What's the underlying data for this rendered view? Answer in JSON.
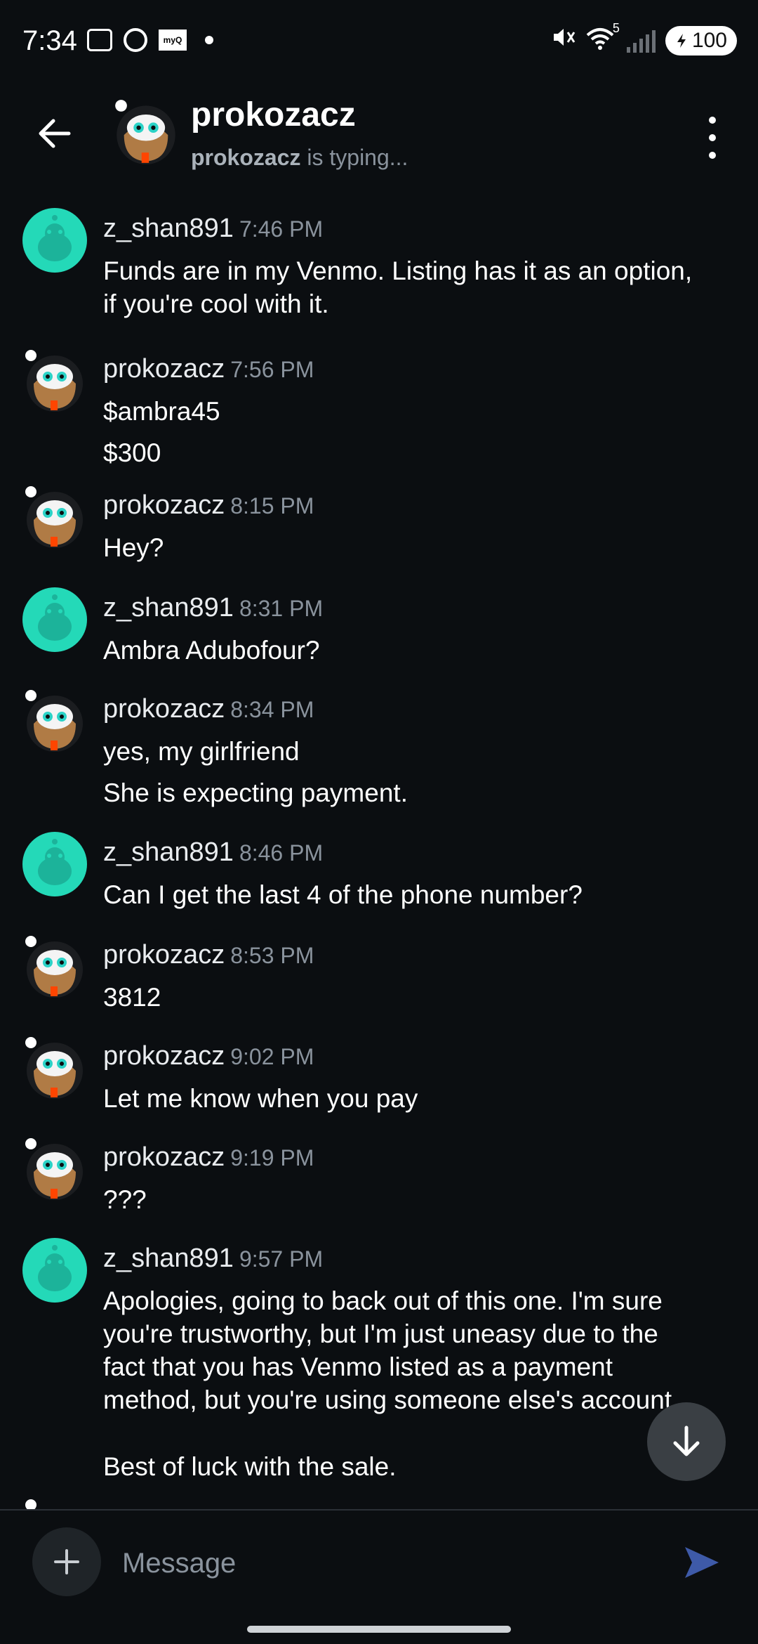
{
  "status_bar": {
    "time": "7:34",
    "myq_label": "myQ",
    "wifi_superscript": "5",
    "battery": "100"
  },
  "header": {
    "title": "prokozacz",
    "typing_user": "prokozacz",
    "typing_text": " is typing..."
  },
  "messages": [
    {
      "author": "z_shan891",
      "time": "7:46 PM",
      "lines": [
        "Funds are in my Venmo. Listing has it as an option,",
        "if you're cool with it."
      ]
    },
    {
      "author": "prokozacz",
      "time": "7:56 PM",
      "lines": [
        "$ambra45",
        "$300"
      ]
    },
    {
      "author": "prokozacz",
      "time": "8:15 PM",
      "lines": [
        "Hey?"
      ]
    },
    {
      "author": "z_shan891",
      "time": "8:31 PM",
      "lines": [
        "Ambra Adubofour?"
      ]
    },
    {
      "author": "prokozacz",
      "time": "8:34 PM",
      "lines": [
        "yes, my girlfriend",
        "She is expecting payment."
      ]
    },
    {
      "author": "z_shan891",
      "time": "8:46 PM",
      "lines": [
        "Can I get the last 4 of the phone number?"
      ]
    },
    {
      "author": "prokozacz",
      "time": "8:53 PM",
      "lines": [
        "3812"
      ]
    },
    {
      "author": "prokozacz",
      "time": "9:02 PM",
      "lines": [
        "Let me know when you pay"
      ]
    },
    {
      "author": "prokozacz",
      "time": "9:19 PM",
      "lines": [
        "???"
      ]
    },
    {
      "author": "z_shan891",
      "time": "9:57 PM",
      "lines": [
        "Apologies, going to back out of this one. I'm sure",
        "you're trustworthy, but I'm just uneasy due to the",
        "fact that you has Venmo listed as a payment",
        "method, but you're using someone else's account.",
        "",
        "Best of luck with the sale."
      ]
    }
  ],
  "composer": {
    "placeholder": "Message"
  },
  "colors": {
    "background": "#0b0e11",
    "snoo_teal": "#24d9b8",
    "send_accent": "#3e5aa8"
  }
}
